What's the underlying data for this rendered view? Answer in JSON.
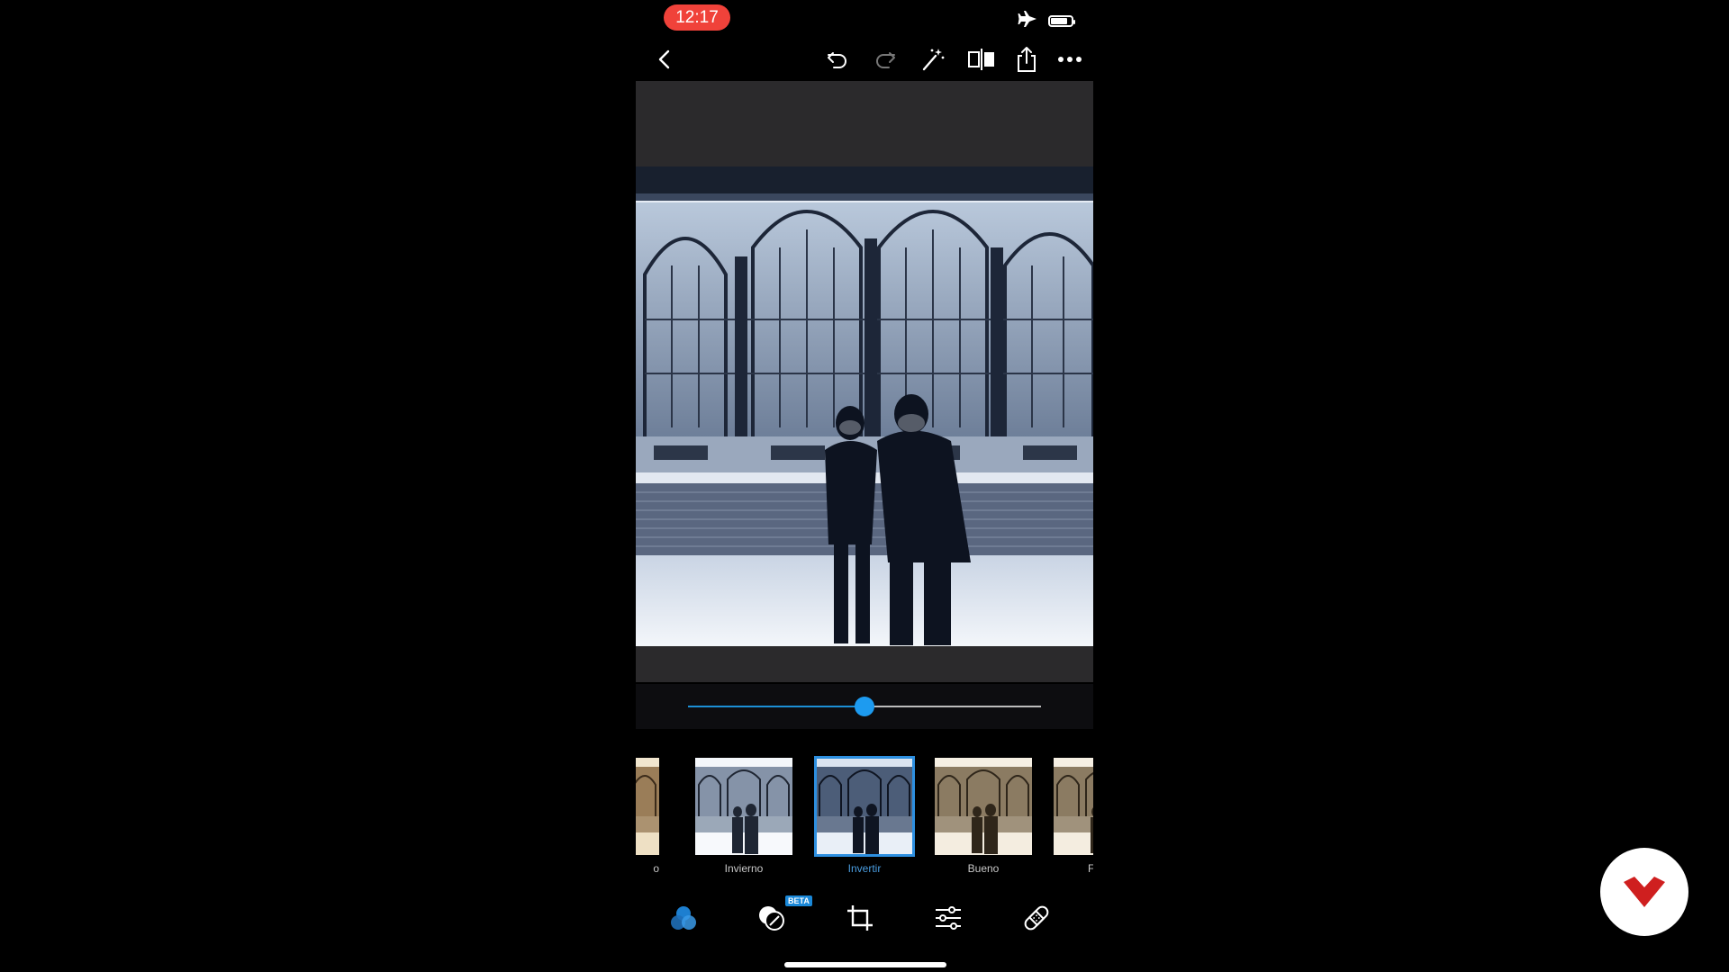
{
  "status_bar": {
    "time": "12:17",
    "airplane_icon": "airplane-icon",
    "battery_level": 0.8
  },
  "toolbar": {
    "back": "chevron-left-icon",
    "undo": "undo-icon",
    "redo": "redo-icon",
    "auto_fix": "magic-wand-icon",
    "compare": "compare-icon",
    "share": "share-icon",
    "more": "more-icon"
  },
  "editor": {
    "intensity": 0.5
  },
  "filters": {
    "items": [
      {
        "label": "o",
        "tone": "sepia"
      },
      {
        "label": "Invierno",
        "tone": "cold"
      },
      {
        "label": "Invertir",
        "tone": "invert",
        "selected": true
      },
      {
        "label": "Bueno",
        "tone": "warm"
      },
      {
        "label": "F",
        "tone": "warm"
      }
    ]
  },
  "bottom_bar": {
    "looks": "looks-icon",
    "overlay": "overlay-icon",
    "beta_label": "BETA",
    "crop": "crop-icon",
    "adjust": "adjust-sliders-icon",
    "heal": "bandage-icon"
  },
  "colors": {
    "accent": "#1d9bf0",
    "time_pill": "#f0423a",
    "canvas": "#2b2a2c"
  }
}
